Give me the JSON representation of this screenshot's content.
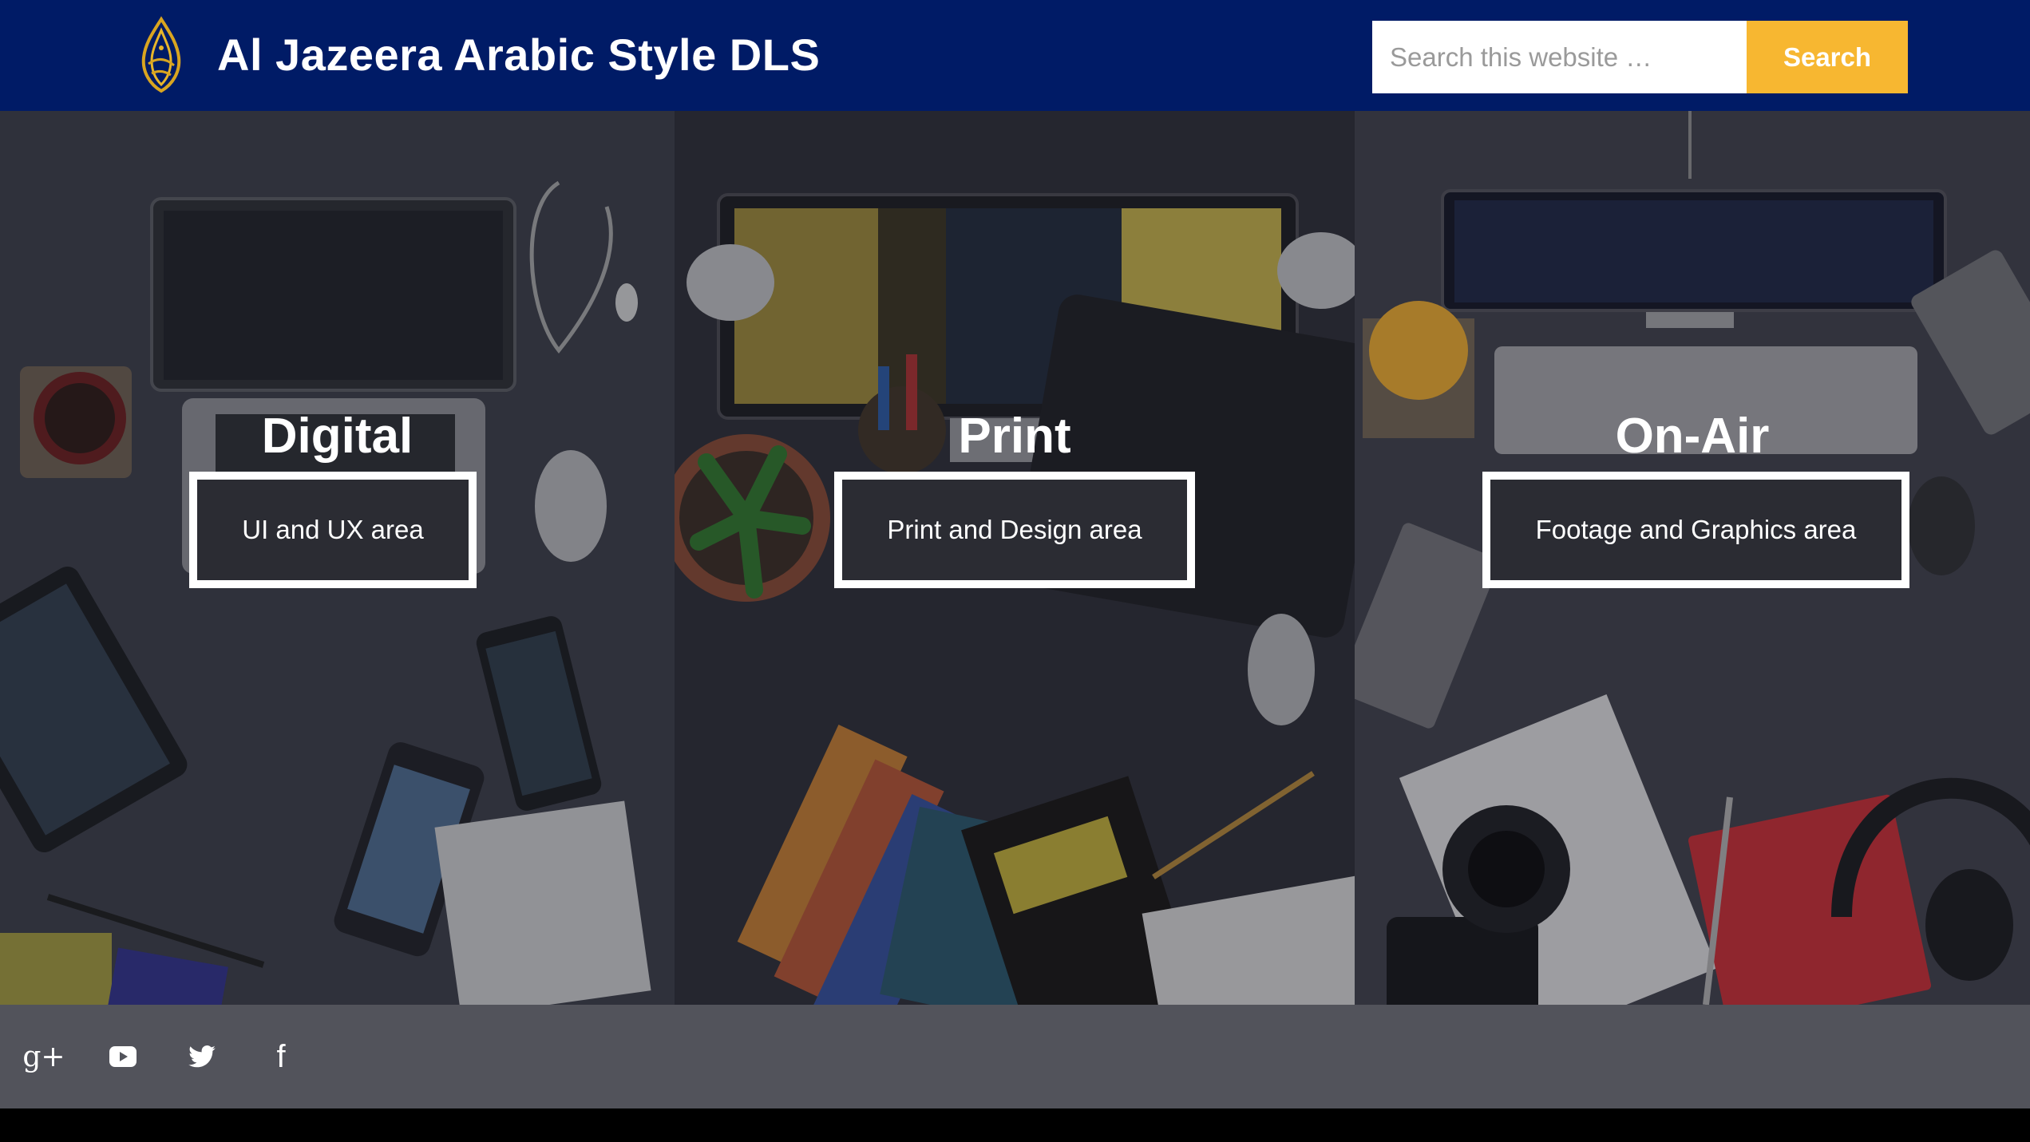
{
  "header": {
    "title": "Al Jazeera Arabic Style DLS",
    "logo_icon": "al-jazeera-logo-icon",
    "brand_color": "#001b66"
  },
  "search": {
    "placeholder": "Search this website …",
    "button_label": "Search",
    "button_color": "#f7b731"
  },
  "panels": [
    {
      "title": "Digital",
      "button_label": "UI and UX area"
    },
    {
      "title": "Print",
      "button_label": "Print and Design area"
    },
    {
      "title": "On-Air",
      "button_label": "Footage and Graphics area"
    }
  ],
  "footer": {
    "social_links": [
      {
        "icon": "google-plus-icon",
        "glyph": "g+"
      },
      {
        "icon": "youtube-icon"
      },
      {
        "icon": "twitter-icon"
      },
      {
        "icon": "facebook-icon",
        "glyph": "f"
      }
    ]
  }
}
